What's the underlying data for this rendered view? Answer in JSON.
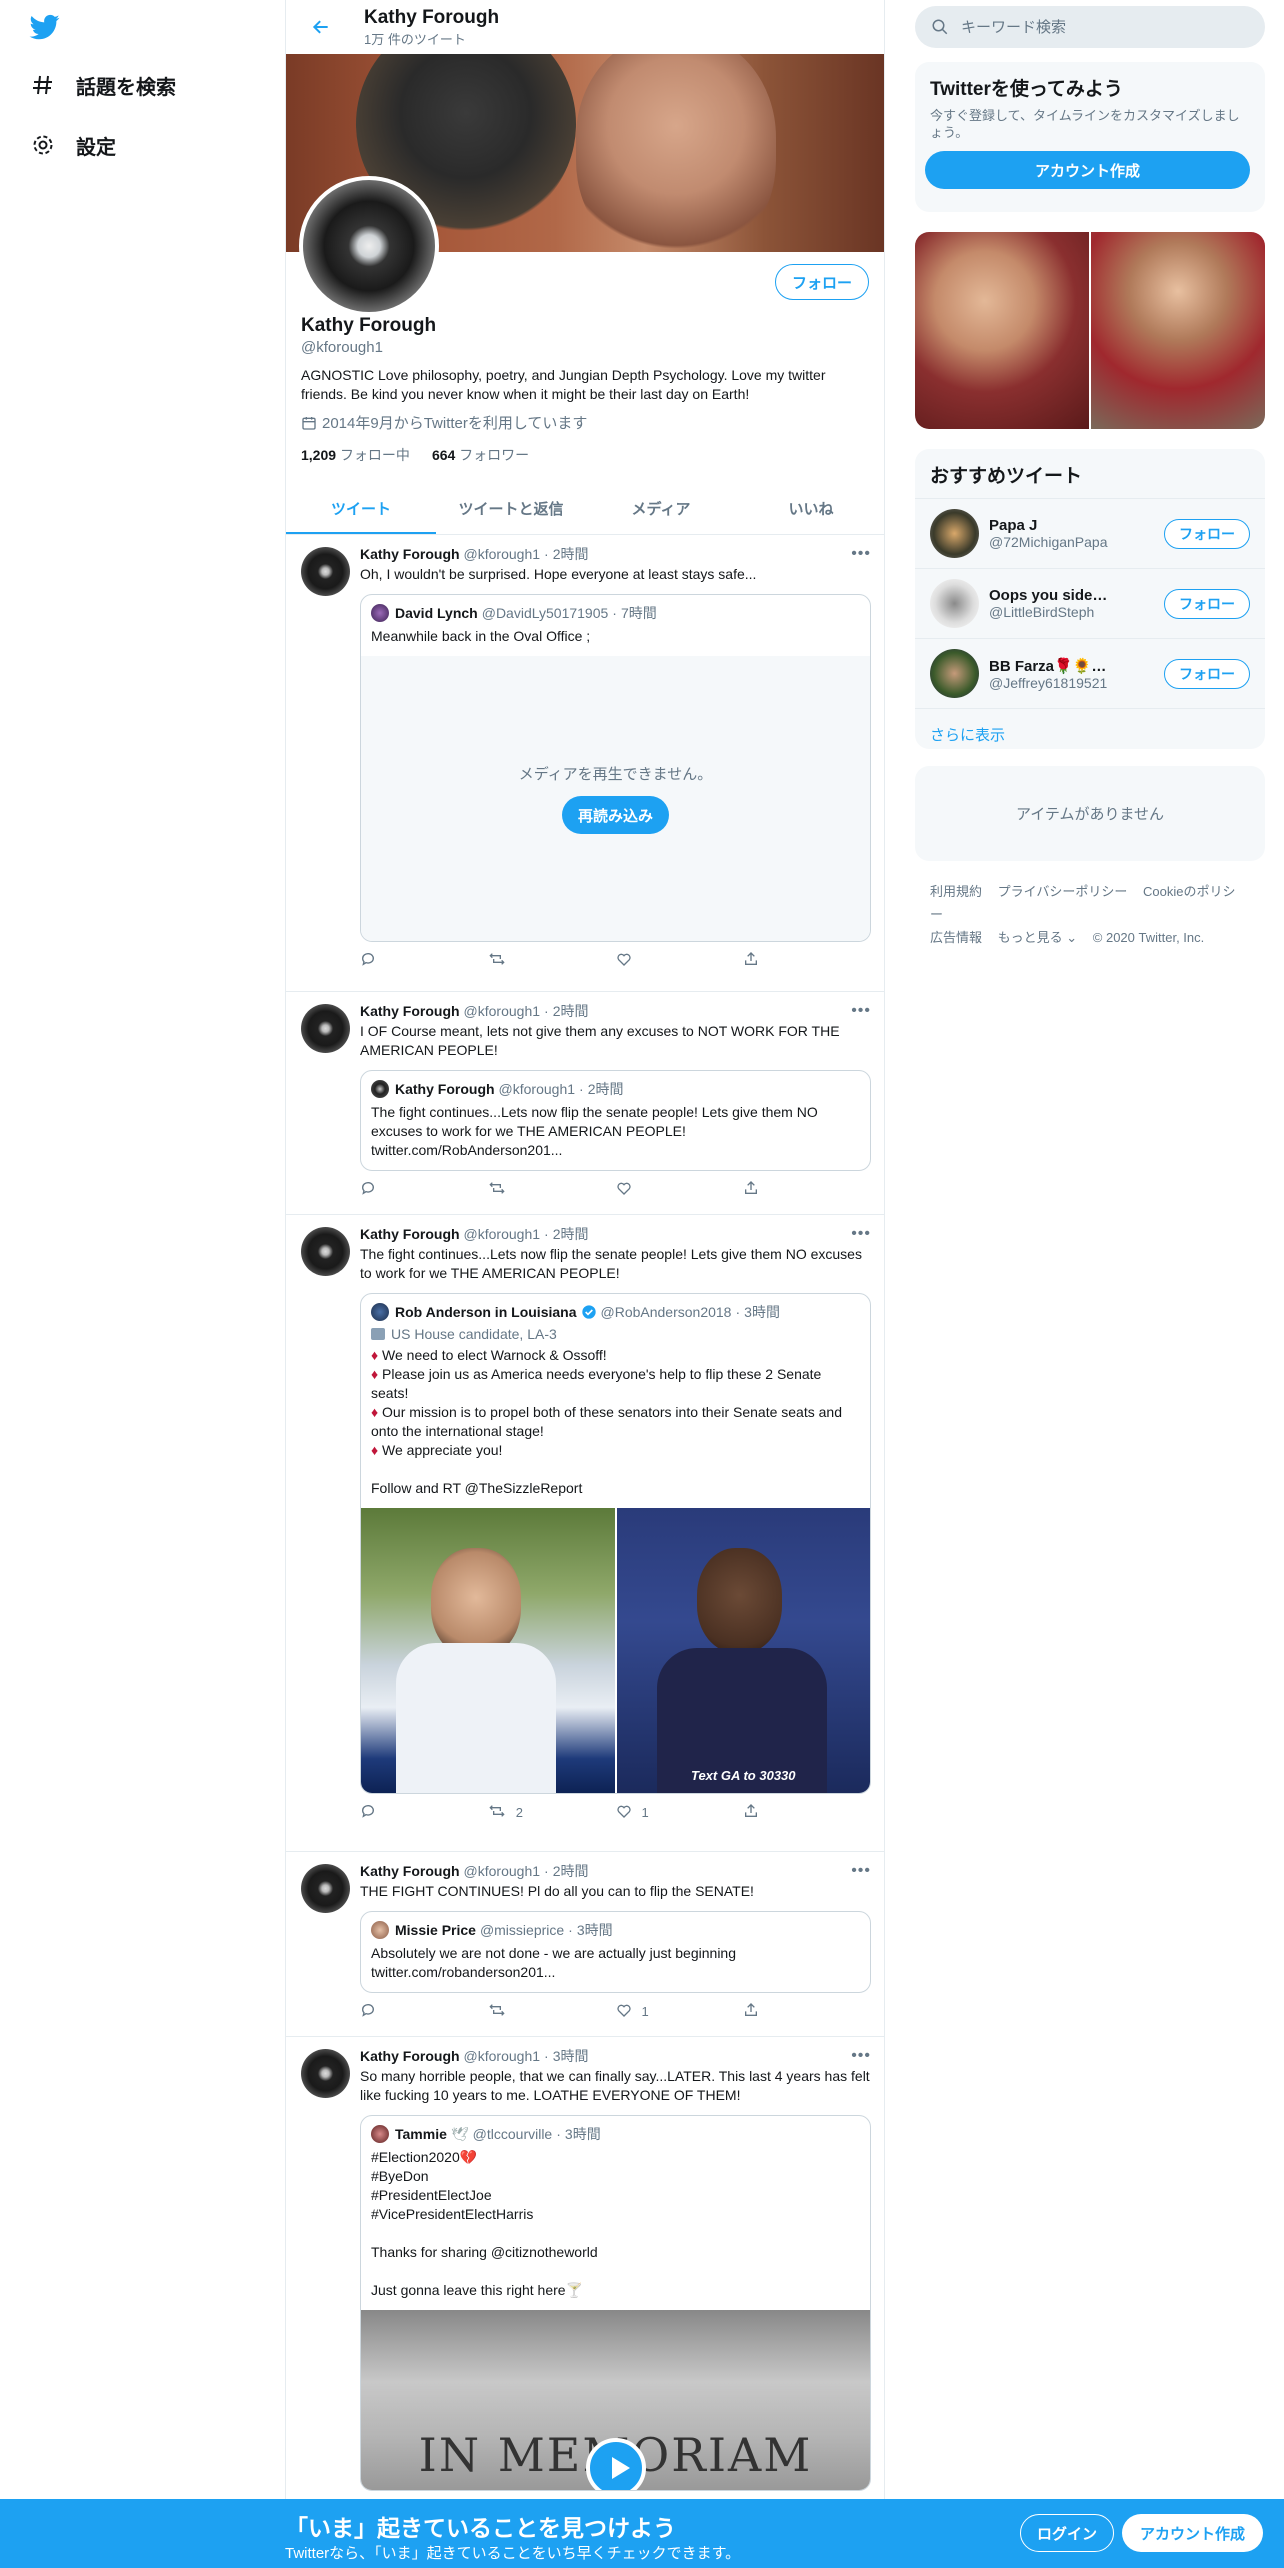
{
  "nav": {
    "explore": "話題を検索",
    "settings": "設定"
  },
  "header": {
    "name": "Kathy Forough",
    "tweet_count": "1万 件のツイート"
  },
  "profile": {
    "follow_label": "フォロー",
    "name": "Kathy Forough",
    "handle": "@kforough1",
    "bio": "AGNOSTIC Love philosophy, poetry, and Jungian Depth Psychology.  Love my twitter friends.  Be kind you never know when it might be their last day on Earth!",
    "joined": "2014年9月からTwitterを利用しています",
    "following_count": "1,209",
    "following_label": "フォロー中",
    "followers_count": "664",
    "followers_label": "フォロワー"
  },
  "tabs": [
    "ツイート",
    "ツイートと返信",
    "メディア",
    "いいね"
  ],
  "tweets": [
    {
      "name": "Kathy Forough",
      "handle": "@kforough1",
      "time": "2時間",
      "text": "Oh, I wouldn't be surprised.  Hope everyone at least stays safe...",
      "quote": {
        "name": "David Lynch",
        "handle": "@DavidLy50171905",
        "time": "7時間",
        "text": "Meanwhile back in the Oval Office ;",
        "media_error": "メディアを再生できません。",
        "reload": "再読み込み"
      },
      "actions": {
        "reply": "",
        "retweet": "",
        "like": ""
      }
    },
    {
      "name": "Kathy Forough",
      "handle": "@kforough1",
      "time": "2時間",
      "text": "I OF Course meant, lets not give them any excuses to NOT WORK FOR THE AMERICAN PEOPLE!",
      "quote": {
        "name": "Kathy Forough",
        "handle": "@kforough1",
        "time": "2時間",
        "text": "The fight continues...Lets now flip the senate people!  Lets give them NO excuses to work for we THE AMERICAN PEOPLE!\ntwitter.com/RobAnderson201..."
      },
      "actions": {
        "reply": "",
        "retweet": "",
        "like": ""
      }
    },
    {
      "name": "Kathy Forough",
      "handle": "@kforough1",
      "time": "2時間",
      "text": "The fight continues...Lets now flip the senate people!  Lets give them NO excuses to work for we THE AMERICAN PEOPLE!",
      "quote": {
        "name": "Rob Anderson in Louisiana",
        "handle": "@RobAnderson2018",
        "time": "3時間",
        "subtitle": "US House candidate, LA-3",
        "lines": [
          "We need to elect Warnock & Ossoff!",
          "Please join us as America needs everyone's help to flip these 2 Senate seats!",
          "Our mission is to propel both of these senators into their Senate seats and onto the international stage!",
          "We appreciate you!"
        ],
        "footer": "Follow and RT @TheSizzleReport"
      },
      "actions": {
        "reply": "",
        "retweet": "2",
        "like": "1"
      }
    },
    {
      "name": "Kathy Forough",
      "handle": "@kforough1",
      "time": "2時間",
      "text": "THE FIGHT CONTINUES!  Pl do all you can to flip the SENATE!",
      "quote": {
        "name": "Missie Price",
        "handle": "@missieprice",
        "time": "3時間",
        "text": "Absolutely we are not done - we are actually just beginning\ntwitter.com/robanderson201..."
      },
      "actions": {
        "reply": "",
        "retweet": "",
        "like": "1"
      }
    },
    {
      "name": "Kathy Forough",
      "handle": "@kforough1",
      "time": "3時間",
      "text": "So many horrible people, that we can finally say...LATER.  This last 4 years has felt like fucking 10 years to me.  LOATHE EVERYONE OF THEM!",
      "quote": {
        "name": "Tammie",
        "handle": "@tlccourville",
        "time": "3時間",
        "text": "#Election2020💔\n#ByeDon\n#PresidentElectJoe\n#VicePresidentElectHarris\n\nThanks for sharing @citiznotheworld\n\nJust gonna leave this right here🍸",
        "video_text": "IN MEMORIAM"
      }
    }
  ],
  "right": {
    "search_placeholder": "キーワード検索",
    "signup_card": {
      "title": "Twitterを使ってみよう",
      "sub": "今すぐ登録して、タイムラインをカスタマイズしましょう。",
      "button": "アカウント作成"
    },
    "recommend": {
      "title": "おすすめツイート",
      "users": [
        {
          "name": "Papa J",
          "handle": "@72MichiganPapa",
          "button": "フォロー"
        },
        {
          "name": "Oops you sided with ...",
          "handle": "@LittleBirdSteph",
          "button": "フォロー"
        },
        {
          "name": "BB Farza🌹🌻🖐🚩☭",
          "handle": "@Jeffrey61819521",
          "button": "フォロー"
        }
      ],
      "more": "さらに表示"
    },
    "empty": "アイテムがありません",
    "footer": [
      "利用規約",
      "プライバシーポリシー",
      "Cookieのポリシー",
      "広告情報",
      "もっと見る ⌄",
      "© 2020 Twitter, Inc."
    ]
  },
  "bottom": {
    "title": "「いま」起きていることを見つけよう",
    "sub": "Twitterなら、「いま」起きていることをいち早くチェックできます。",
    "login": "ログイン",
    "signup": "アカウント作成"
  },
  "colors": {
    "accent": "#1da1f2",
    "text": "#14171a",
    "muted": "#657786"
  }
}
